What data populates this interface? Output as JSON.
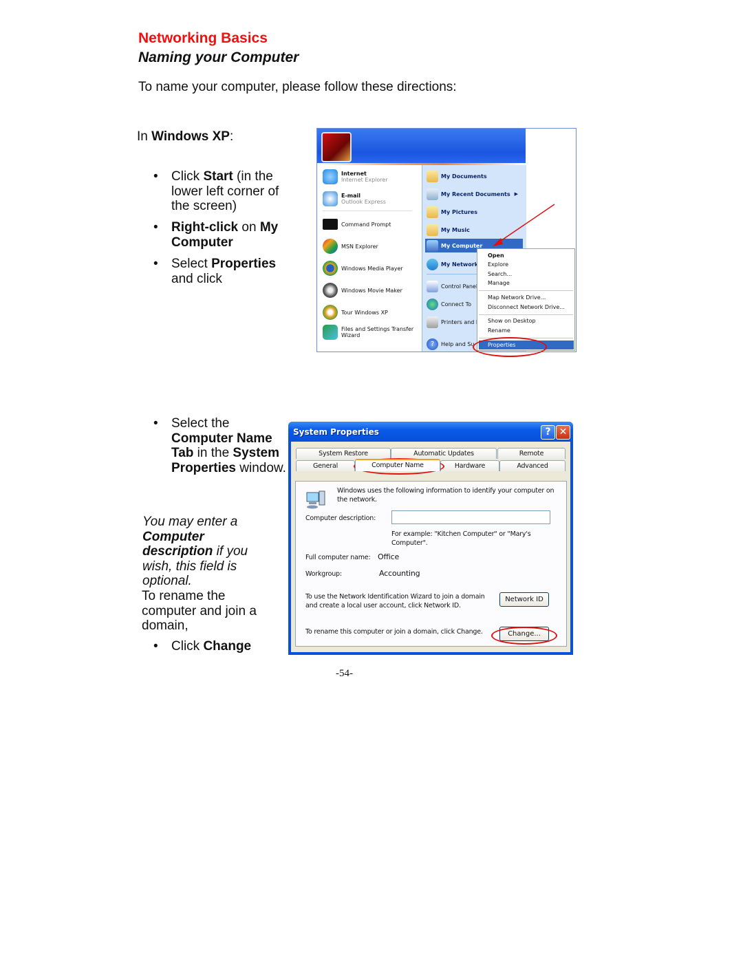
{
  "header": {
    "section": "Networking Basics",
    "title": "Naming your Computer",
    "intro": "To name your computer, please follow these directions:"
  },
  "os_heading": {
    "prefix": "In ",
    "os": "Windows XP",
    "suffix": ":"
  },
  "steps1": [
    {
      "pre": "Click ",
      "bold": "Start",
      "post": " (in the lower left corner of the screen)"
    },
    {
      "bold1": "Right-click",
      "mid": " on ",
      "bold2": "My Computer"
    },
    {
      "pre": "Select ",
      "bold": "Properties",
      "post": " and click"
    }
  ],
  "steps2": {
    "select_pre": "Select the",
    "select_bold1": "Computer Name Tab",
    "select_mid": " in the ",
    "select_bold2": "System Properties",
    "select_post": " window.",
    "note_pre": "You may enter a ",
    "note_bold": "Computer description",
    "note_post": " if you wish, this field is optional.",
    "rename": "To rename the computer and join a domain,",
    "click_pre": "Click ",
    "click_bold": "Change"
  },
  "start_menu": {
    "pinned": [
      {
        "name": "Internet",
        "sub": "Internet Explorer",
        "color": "#1e88e5"
      },
      {
        "name": "E-mail",
        "sub": "Outlook Express",
        "color": "#3a8ee0"
      }
    ],
    "recent": [
      {
        "name": "Command Prompt",
        "color": "#111111"
      },
      {
        "name": "MSN Explorer",
        "color": "#e86a20"
      },
      {
        "name": "Windows Media Player",
        "color": "#2a8a2a"
      },
      {
        "name": "Windows Movie Maker",
        "color": "#606060"
      },
      {
        "name": "Tour Windows XP",
        "color": "#e0a020"
      },
      {
        "name": "Files and Settings Transfer Wizard",
        "color": "#2a9a4a"
      }
    ],
    "places": [
      {
        "name": "My Documents",
        "bold": true,
        "arrow": false
      },
      {
        "name": "My Recent Documents",
        "bold": true,
        "arrow": true
      },
      {
        "name": "My Pictures",
        "bold": true,
        "arrow": false
      },
      {
        "name": "My Music",
        "bold": true,
        "arrow": false
      },
      {
        "name": "My Computer",
        "bold": true,
        "arrow": false,
        "selected": true
      },
      {
        "name": "My Network",
        "bold": true,
        "arrow": false
      },
      {
        "name": "Control Panel",
        "bold": false,
        "arrow": false
      },
      {
        "name": "Connect To",
        "bold": false,
        "arrow": false
      },
      {
        "name": "Printers and F",
        "bold": false,
        "arrow": false
      },
      {
        "name": "Help and Su",
        "bold": false,
        "arrow": false
      }
    ]
  },
  "context_menu": {
    "items": [
      "Open",
      "Explore",
      "Search...",
      "Manage",
      "Map Network Drive...",
      "Disconnect Network Drive...",
      "Show on Desktop",
      "Rename",
      "Properties"
    ],
    "selected": "Properties"
  },
  "dialog": {
    "title": "System Properties",
    "help": "?",
    "close": "✕",
    "tabs_row1": [
      "System Restore",
      "Automatic Updates",
      "Remote"
    ],
    "tabs_row2": [
      "General",
      "Computer Name",
      "Hardware",
      "Advanced"
    ],
    "active_tab": "Computer Name",
    "info": "Windows uses the following information to identify your computer on the network.",
    "desc_label": "Computer description:",
    "desc_value": "",
    "example": "For example: \"Kitchen Computer\" or \"Mary's Computer\".",
    "full_name_label": "Full computer name:",
    "full_name_value": "Office",
    "workgroup_label": "Workgroup:",
    "workgroup_value": "Accounting",
    "netid_text": "To use the Network Identification Wizard to join a domain and create a local user account, click Network ID.",
    "netid_button": "Network ID",
    "change_text": "To rename this computer or join a domain, click Change.",
    "change_button": "Change..."
  },
  "annotation_color": "#e01010",
  "page_number": "-54-"
}
